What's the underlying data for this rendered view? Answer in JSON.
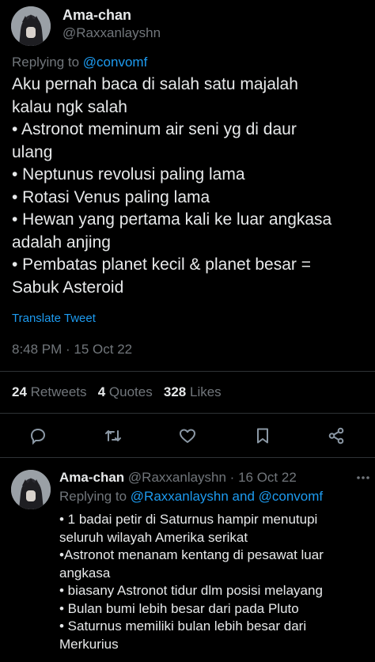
{
  "main_tweet": {
    "display_name": "Ama-chan",
    "handle": "@Raxxanlayshn",
    "replying_prefix": "Replying to",
    "replying_to": "@convomf",
    "lines": [
      "Aku pernah baca di salah satu majalah",
      "kalau ngk salah",
      "• Astronot meminum air seni yg di daur",
      "ulang",
      "• Neptunus revolusi paling lama",
      "• Rotasi Venus paling lama",
      "• Hewan yang pertama kali ke luar angkasa",
      "adalah anjing",
      "• Pembatas planet kecil & planet besar =",
      "Sabuk Asteroid"
    ],
    "translate_label": "Translate Tweet",
    "timestamp": "8:48 PM · 15 Oct 22",
    "stats": {
      "retweets_count": "24",
      "retweets_label": "Retweets",
      "quotes_count": "4",
      "quotes_label": "Quotes",
      "likes_count": "328",
      "likes_label": "Likes"
    }
  },
  "actions": [
    "reply-icon",
    "retweet-icon",
    "like-icon",
    "bookmark-icon",
    "share-icon"
  ],
  "reply_tweet": {
    "display_name": "Ama-chan",
    "handle_date": "@Raxxanlayshn · 16 Oct 22",
    "replying_prefix": "Replying to",
    "replying_to": "@Raxxanlayshn and @convomf",
    "lines": [
      "• 1 badai petir di Saturnus hampir menutupi",
      "seluruh wilayah Amerika serikat",
      "•Astronot menanam kentang di pesawat luar",
      "angkasa",
      "• biasany Astronot tidur dlm posisi melayang",
      "• Bulan bumi lebih besar dari pada Pluto",
      "• Saturnus memiliki bulan lebih besar dari",
      "Merkurius"
    ]
  },
  "colors": {
    "background": "#000000",
    "text": "#e7e9ea",
    "muted": "#71767b",
    "accent": "#1d9bf0",
    "divider": "#2f3336"
  }
}
